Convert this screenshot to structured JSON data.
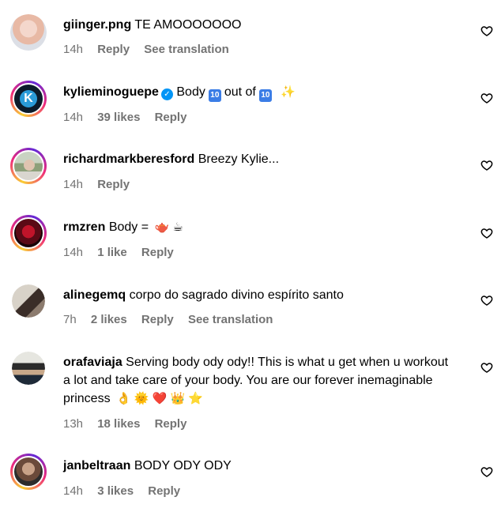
{
  "comments": [
    {
      "username": "giinger.png",
      "text": "TE AMOOOOOOO",
      "time": "14h",
      "likes": "",
      "reply": "Reply",
      "translate": "See translation",
      "emojis": ""
    },
    {
      "username": "kylieminoguepe",
      "text": "Body",
      "text2": "out of",
      "ten": "10",
      "time": "14h",
      "likes": "39 likes",
      "reply": "Reply",
      "emojis": "✨"
    },
    {
      "username": "richardmarkberesford",
      "text": "Breezy Kylie...",
      "time": "14h",
      "likes": "",
      "reply": "Reply"
    },
    {
      "username": "rmzren",
      "text": "Body =",
      "time": "14h",
      "likes": "1 like",
      "reply": "Reply",
      "emojis": "🫖 ☕"
    },
    {
      "username": "alinegemq",
      "text": "corpo do sagrado divino espírito santo",
      "time": "7h",
      "likes": "2 likes",
      "reply": "Reply",
      "translate": "See translation"
    },
    {
      "username": "orafaviaja",
      "text": "Serving body ody ody!! This is what u get when u workout a lot and take care of your body. You are our forever inemaginable princess",
      "time": "13h",
      "likes": "18 likes",
      "reply": "Reply",
      "emojis": "👌 🌞 ❤️ 👑 ⭐"
    },
    {
      "username": "janbeltraan",
      "text": "BODY ODY ODY",
      "time": "14h",
      "likes": "3 likes",
      "reply": "Reply"
    }
  ],
  "icons": {
    "like": "heart-outline-icon",
    "verified": "verified-badge-icon"
  }
}
